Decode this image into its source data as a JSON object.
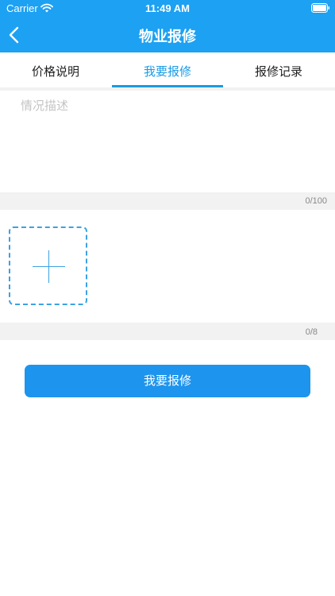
{
  "status_bar": {
    "carrier": "Carrier",
    "time": "11:49 AM",
    "wifi_icon": "wifi-icon",
    "battery_icon": "battery-icon"
  },
  "nav": {
    "title": "物业报修",
    "back_icon": "chevron-left-icon"
  },
  "tabs": {
    "items": [
      {
        "label": "价格说明"
      },
      {
        "label": "我要报修"
      },
      {
        "label": "报修记录"
      }
    ],
    "active_index": 1
  },
  "description": {
    "placeholder": "情况描述",
    "value": "",
    "counter": "0/100"
  },
  "photos": {
    "add_icon": "plus-icon",
    "counter": "0/8"
  },
  "submit": {
    "label": "我要报修"
  },
  "colors": {
    "header_bg": "#1da1f2",
    "accent": "#1a9be6",
    "button_bg": "#1d94ee",
    "gap_bg": "#f2f2f2",
    "dashed_border": "#3ba2e3"
  }
}
